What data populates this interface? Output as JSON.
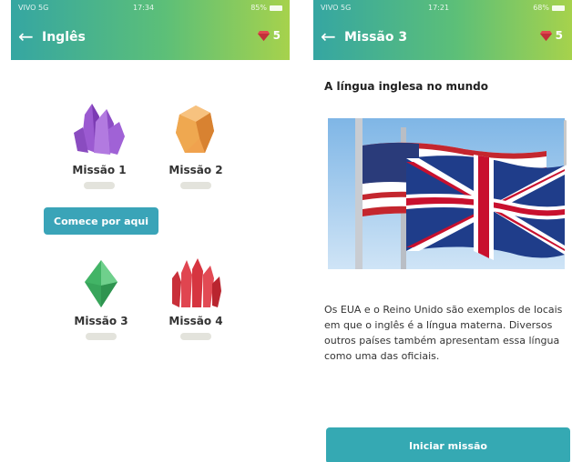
{
  "colors": {
    "header_start": "#35a6a2",
    "header_end": "#a6d24c",
    "button": "#3aa4b8",
    "gem": "#e0484f"
  },
  "left_screen": {
    "status": {
      "carrier": "VIVO 5G",
      "time": "17:34",
      "battery": "85%"
    },
    "header": {
      "back_icon": "arrow-left-icon",
      "title": "Inglês",
      "gem_icon": "ruby-gem-icon",
      "gems": "5"
    },
    "missions": [
      {
        "label": "Missão 1",
        "icon": "purple-crystal-icon",
        "progress": 0
      },
      {
        "label": "Missão 2",
        "icon": "orange-crystal-icon",
        "progress": 0
      },
      {
        "label": "Missão 3",
        "icon": "green-crystal-icon",
        "progress": 0
      },
      {
        "label": "Missão 4",
        "icon": "red-crystal-icon",
        "progress": 0
      }
    ],
    "start_button": "Comece por aqui"
  },
  "right_screen": {
    "status": {
      "carrier": "VIVO 5G",
      "time": "17:21",
      "battery": "68%"
    },
    "header": {
      "back_icon": "arrow-left-icon",
      "title": "Missão 3",
      "gem_icon": "ruby-gem-icon",
      "gems": "5"
    },
    "article_title": "A língua inglesa no mundo",
    "image": "usa-and-uk-flags-photo",
    "paragraph": "Os EUA e o Reino Unido são exemplos de locais em que o inglês é a língua materna. Diversos outros países também apresentam essa língua como uma das oficiais.",
    "cta_button": "Iniciar missão"
  }
}
